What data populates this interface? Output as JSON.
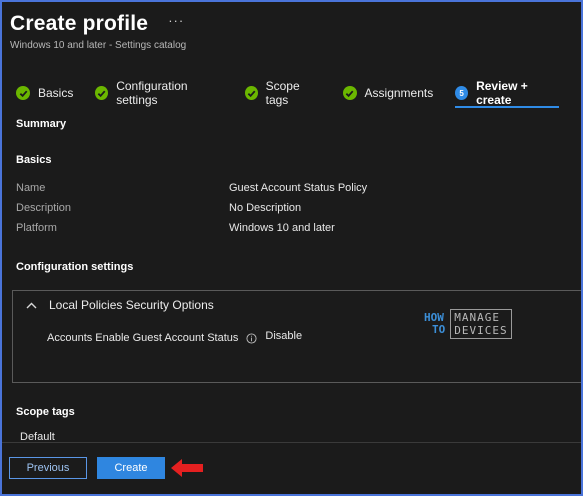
{
  "header": {
    "title": "Create profile",
    "more_label": "···",
    "subtitle": "Windows 10 and later - Settings catalog"
  },
  "steps": [
    {
      "label": "Basics",
      "state": "done"
    },
    {
      "label": "Configuration settings",
      "state": "done"
    },
    {
      "label": "Scope tags",
      "state": "done"
    },
    {
      "label": "Assignments",
      "state": "done"
    },
    {
      "label": "Review + create",
      "state": "active",
      "number": "5"
    }
  ],
  "summary": {
    "heading": "Summary",
    "basics_heading": "Basics",
    "basics": [
      {
        "label": "Name",
        "value": "Guest Account Status Policy"
      },
      {
        "label": "Description",
        "value": "No Description"
      },
      {
        "label": "Platform",
        "value": "Windows 10 and later"
      }
    ],
    "config_heading": "Configuration settings",
    "group_title": "Local Policies Security Options",
    "setting_name": "Accounts Enable Guest Account Status",
    "setting_value": "Disable",
    "scope_heading": "Scope tags",
    "scope_value": "Default"
  },
  "watermark": {
    "left_top": "HOW",
    "left_bottom": "TO",
    "right_top": "MANAGE",
    "right_bottom": "DEVICES"
  },
  "footer": {
    "previous_label": "Previous",
    "create_label": "Create"
  },
  "colors": {
    "accent": "#2f8be6",
    "success": "#6bb700",
    "annotation_arrow": "#e52020",
    "frame_border": "#4a74d9"
  }
}
